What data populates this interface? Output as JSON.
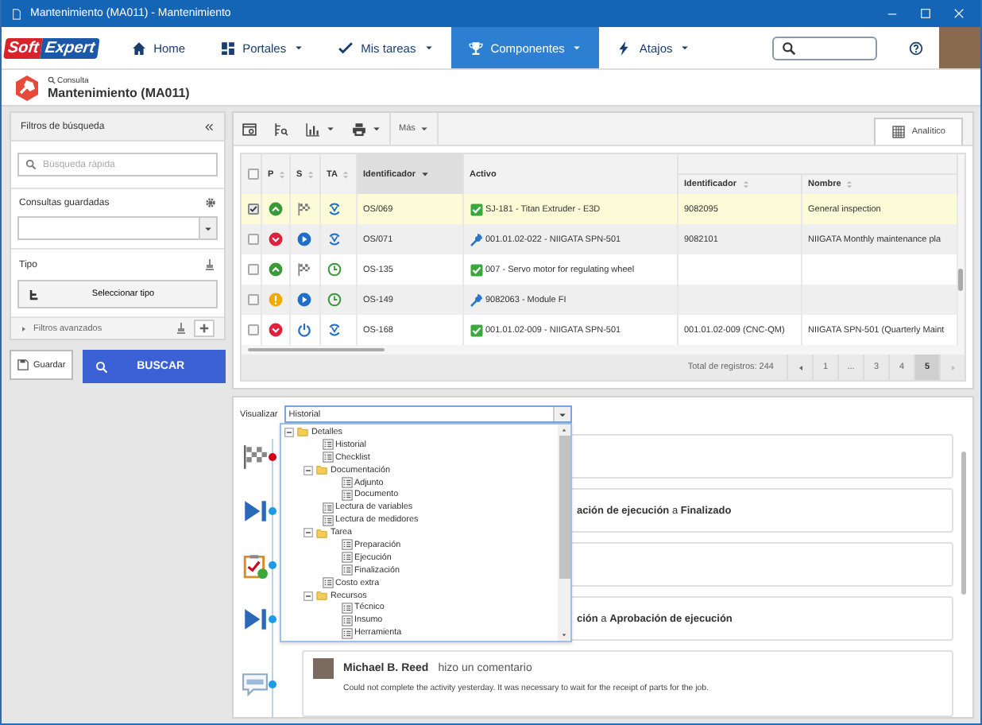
{
  "window": {
    "title": "Mantenimiento (MA011) - Mantenimiento"
  },
  "logo": {
    "first": "Soft",
    "second": "Expert"
  },
  "nav": [
    {
      "label": "Home",
      "kind": "home",
      "dropdown": false,
      "selected": false
    },
    {
      "label": "Portales",
      "kind": "grid",
      "dropdown": true,
      "selected": false
    },
    {
      "label": "Mis tareas",
      "kind": "check",
      "dropdown": true,
      "selected": false
    },
    {
      "label": "Componentes",
      "kind": "trophy",
      "dropdown": true,
      "selected": true
    },
    {
      "label": "Atajos",
      "kind": "bolt",
      "dropdown": true,
      "selected": false
    }
  ],
  "page_header": {
    "breadcrumb": "Consulta",
    "title": "Mantenimiento (MA011)"
  },
  "filters": {
    "title": "Filtros de búsqueda",
    "search_placeholder": "Búsqueda rápida",
    "saved_queries_label": "Consultas guardadas",
    "type_label": "Tipo",
    "type_button": "Seleccionar tipo",
    "advanced_label": "Filtros avanzados",
    "save_button": "Guardar",
    "search_button": "BUSCAR"
  },
  "toolbar": {
    "more_label": "Más",
    "tab": "Analítico"
  },
  "table": {
    "select_all": {
      "checked": false
    },
    "columns": [
      {
        "label": "P",
        "sort": {
          "kind": "unsorted"
        }
      },
      {
        "label": "S",
        "sort": {
          "kind": "unsorted"
        }
      },
      {
        "label": "TA",
        "sort": {
          "kind": "unsorted"
        }
      },
      {
        "label": "Identificador",
        "sort": {
          "kind": "descending"
        }
      },
      {
        "label": "Activo"
      },
      {
        "label": "Identificador",
        "sort": {
          "kind": "unsorted"
        }
      },
      {
        "label": "Nombre",
        "sort": {
          "kind": "unsorted"
        }
      }
    ],
    "rows": [
      {
        "checked": true,
        "selected": true,
        "priority": {
          "kind": "up"
        },
        "status": {
          "kind": "flag"
        },
        "type": {
          "kind": "cycle"
        },
        "id": "OS/069",
        "asset": {
          "kind": "check",
          "label": "SJ-181 - Titan Extruder - E3D"
        },
        "asset_id": "9082095",
        "name": "General inspection"
      },
      {
        "checked": false,
        "selected": false,
        "priority": {
          "kind": "down"
        },
        "status": {
          "kind": "play"
        },
        "type": {
          "kind": "cycle"
        },
        "id": "OS/071",
        "asset": {
          "kind": "wrench",
          "label": "001.01.02-022 - NIIGATA SPN-501"
        },
        "asset_id": "9082101",
        "name": "NIIGATA Monthly maintenance pla"
      },
      {
        "checked": false,
        "selected": false,
        "priority": {
          "kind": "up"
        },
        "status": {
          "kind": "flag"
        },
        "type": {
          "kind": "clock"
        },
        "id": "OS-135",
        "asset": {
          "kind": "check",
          "label": "007 - Servo motor for regulating wheel"
        }
      },
      {
        "checked": false,
        "selected": false,
        "priority": {
          "kind": "alert"
        },
        "status": {
          "kind": "play"
        },
        "type": {
          "kind": "clock"
        },
        "id": "OS-149",
        "asset": {
          "kind": "wrench",
          "label": "9082063 - Module FI"
        }
      },
      {
        "checked": false,
        "selected": false,
        "priority": {
          "kind": "down"
        },
        "status": {
          "kind": "power"
        },
        "type": {
          "kind": "cycle"
        },
        "id": "OS-168",
        "asset": {
          "kind": "check",
          "label": "001.01.02-009 - NIIGATA SPN-501"
        },
        "asset_id": "001.01.02-009 (CNC-QM)",
        "name": "NIIGATA SPN-501 (Quarterly Maint"
      }
    ]
  },
  "pager": {
    "total": "Total de registros: 244",
    "pages": [
      {
        "label": "1",
        "selected": false
      },
      {
        "label": "...",
        "selected": false
      },
      {
        "label": "3",
        "selected": false
      },
      {
        "label": "4",
        "selected": false
      },
      {
        "label": "5",
        "selected": true
      }
    ]
  },
  "viewer": {
    "label": "Visualizar",
    "value": "Historial",
    "tree": [
      {
        "label": "Detalles",
        "kind": "folder",
        "expanded": true,
        "children": [
          {
            "label": "Historial",
            "kind": "leaf"
          },
          {
            "label": "Checklist",
            "kind": "leaf"
          },
          {
            "label": "Documentación",
            "kind": "folder",
            "expanded": true,
            "children": [
              {
                "label": "Adjunto",
                "kind": "leaf"
              },
              {
                "label": "Documento",
                "kind": "leaf"
              }
            ]
          },
          {
            "label": "Lectura de variables",
            "kind": "leaf"
          },
          {
            "label": "Lectura de medidores",
            "kind": "leaf"
          },
          {
            "label": "Tarea",
            "kind": "folder",
            "expanded": true,
            "children": [
              {
                "label": "Preparación",
                "kind": "leaf"
              },
              {
                "label": "Ejecución",
                "kind": "leaf"
              },
              {
                "label": "Finalización",
                "kind": "leaf"
              }
            ]
          },
          {
            "label": "Costo extra",
            "kind": "leaf"
          },
          {
            "label": "Recursos",
            "kind": "folder",
            "expanded": true,
            "children": [
              {
                "label": "Técnico",
                "kind": "leaf"
              },
              {
                "label": "Insumo",
                "kind": "leaf"
              },
              {
                "label": "Herramienta",
                "kind": "leaf"
              }
            ]
          }
        ]
      }
    ]
  },
  "timeline": [
    {
      "kind": "finish",
      "color": "#d0021b"
    },
    {
      "kind": "transition",
      "color": "#1e9be6",
      "text": "**ación de ejecución** a **Finalizado**"
    },
    {
      "kind": "checklist",
      "color": "#1e9be6"
    },
    {
      "kind": "transition",
      "color": "#1e9be6",
      "text": "**ción** a **Aprobación de ejecución**"
    },
    {
      "kind": "comment",
      "color": "#1e9be6",
      "author": "Michael B. Reed",
      "action": "hizo un comentario",
      "body": "Could not complete the activity yesterday. It was necessary to wait for the receipt of parts for the job."
    }
  ]
}
